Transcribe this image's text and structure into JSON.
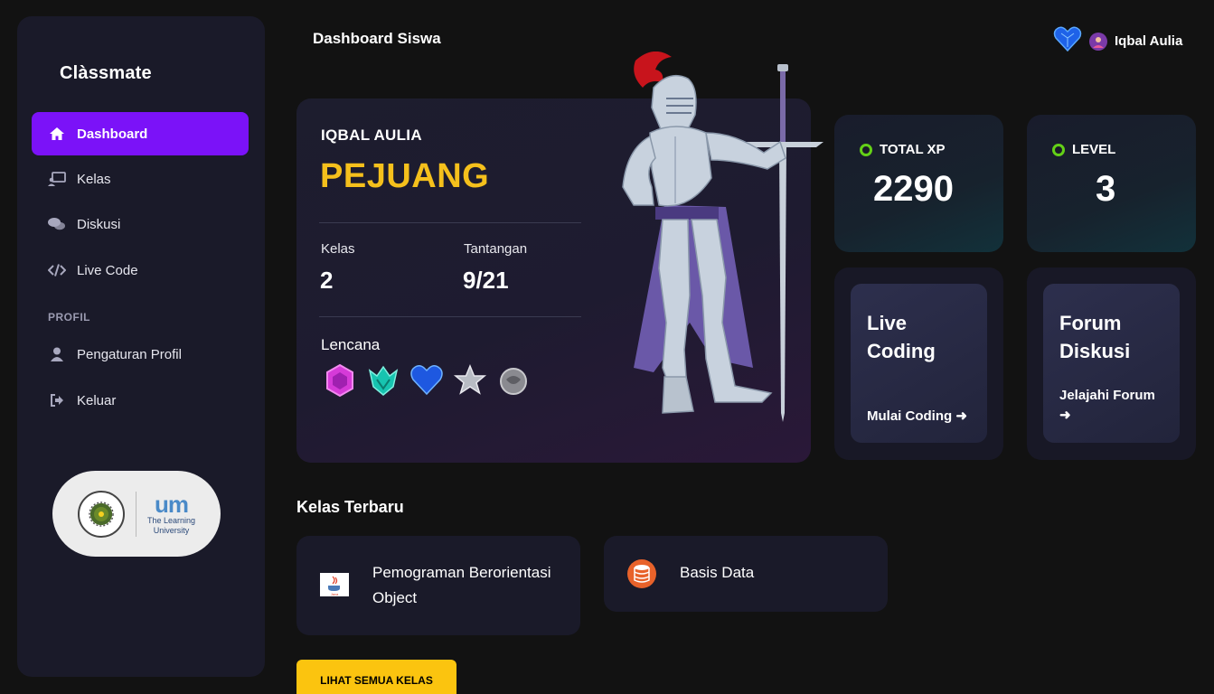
{
  "app": {
    "name": "Clàssmate"
  },
  "header": {
    "title": "Dashboard Siswa",
    "user_name": "Iqbal Aulia"
  },
  "sidebar": {
    "items": [
      {
        "label": "Dashboard",
        "icon": "home-icon",
        "active": true
      },
      {
        "label": "Kelas",
        "icon": "class-icon"
      },
      {
        "label": "Diskusi",
        "icon": "chat-icon"
      },
      {
        "label": "Live Code",
        "icon": "code-icon"
      }
    ],
    "section_profile": "PROFIL",
    "profile_items": [
      {
        "label": "Pengaturan Profil",
        "icon": "user-icon"
      },
      {
        "label": "Keluar",
        "icon": "logout-icon"
      }
    ],
    "partner": {
      "mark": "um",
      "line1": "The Learning",
      "line2": "University"
    }
  },
  "hero": {
    "name": "IQBAL AULIA",
    "rank": "PEJUANG",
    "kelas_label": "Kelas",
    "kelas_value": "2",
    "tantangan_label": "Tantangan",
    "tantangan_value": "9/21",
    "badges_label": "Lencana",
    "badges": [
      "pink-gem-badge",
      "teal-crown-badge",
      "blue-heart-badge",
      "silver-star-badge",
      "grey-orb-badge"
    ]
  },
  "stats": {
    "xp_label": "TOTAL XP",
    "xp_value": "2290",
    "level_label": "LEVEL",
    "level_value": "3"
  },
  "actions": {
    "live_title": "Live Coding",
    "live_link": "Mulai Coding",
    "forum_title": "Forum Diskusi",
    "forum_link": "Jelajahi Forum"
  },
  "classes": {
    "title": "Kelas Terbaru",
    "items": [
      {
        "name": "Pemograman Berorientasi Object",
        "icon": "java-icon"
      },
      {
        "name": "Basis Data",
        "icon": "database-icon"
      }
    ],
    "view_all": "LIHAT SEMUA KELAS"
  },
  "colors": {
    "accent": "#7b12f8",
    "rank": "#f5c01c",
    "xp_dot": "#63d017",
    "button": "#fbc40f"
  }
}
